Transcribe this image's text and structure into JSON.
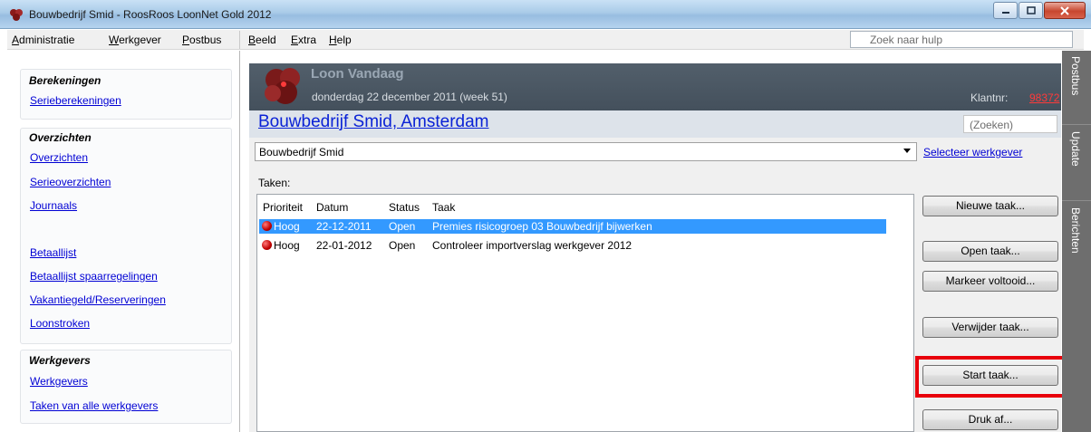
{
  "window": {
    "title": "Bouwbedrijf Smid - RoosRoos LoonNet Gold 2012"
  },
  "menu": {
    "items": [
      {
        "label": "Administratie"
      },
      {
        "label": "Werkgever"
      },
      {
        "label": "Postbus"
      },
      {
        "label": "Beeld"
      },
      {
        "label": "Extra"
      },
      {
        "label": "Help"
      }
    ],
    "help_search_placeholder": "Zoek naar hulp"
  },
  "sidebar": {
    "groups": [
      {
        "heading": "Berekeningen",
        "links": [
          "Serieberekeningen"
        ]
      },
      {
        "heading": "Overzichten",
        "links": [
          "Overzichten",
          "Serieoverzichten",
          "Journaals",
          "Betaallijst",
          "Betaallijst spaarregelingen",
          "Vakantiegeld/Reserveringen",
          "Loonstroken"
        ]
      },
      {
        "heading": "Werkgevers",
        "links": [
          "Werkgevers",
          "Taken van alle werkgevers"
        ]
      }
    ]
  },
  "header": {
    "title": "Loon Vandaag",
    "date": "donderdag 22 december 2011 (week 51)",
    "client_label": "Klantnr:",
    "client_number": "98372"
  },
  "company": {
    "name": "Bouwbedrijf Smid, Amsterdam",
    "search_placeholder": "(Zoeken)",
    "selected_employer": "Bouwbedrijf Smid",
    "select_link": "Selecteer werkgever"
  },
  "tasks": {
    "label": "Taken:",
    "columns": [
      "Prioriteit",
      "Datum",
      "Status",
      "Taak"
    ],
    "rows": [
      {
        "priority": "Hoog",
        "date": "22-12-2011",
        "status": "Open",
        "task": "Premies risicogroep 03 Bouwbedrijf bijwerken",
        "selected": true
      },
      {
        "priority": "Hoog",
        "date": "22-01-2012",
        "status": "Open",
        "task": "Controleer importverslag werkgever 2012",
        "selected": false
      }
    ]
  },
  "buttons": {
    "new_task": "Nieuwe taak...",
    "open_task": "Open taak...",
    "mark_done": "Markeer voltooid...",
    "delete_task": "Verwijder taak...",
    "start_task": "Start taak...",
    "print": "Druk af..."
  },
  "side_tabs": [
    "Postbus",
    "Update",
    "Berichten"
  ],
  "colors": {
    "link": "#0000d4",
    "selection": "#3399ff",
    "highlight": "#e8000b",
    "header_bg": "#4b5762"
  }
}
